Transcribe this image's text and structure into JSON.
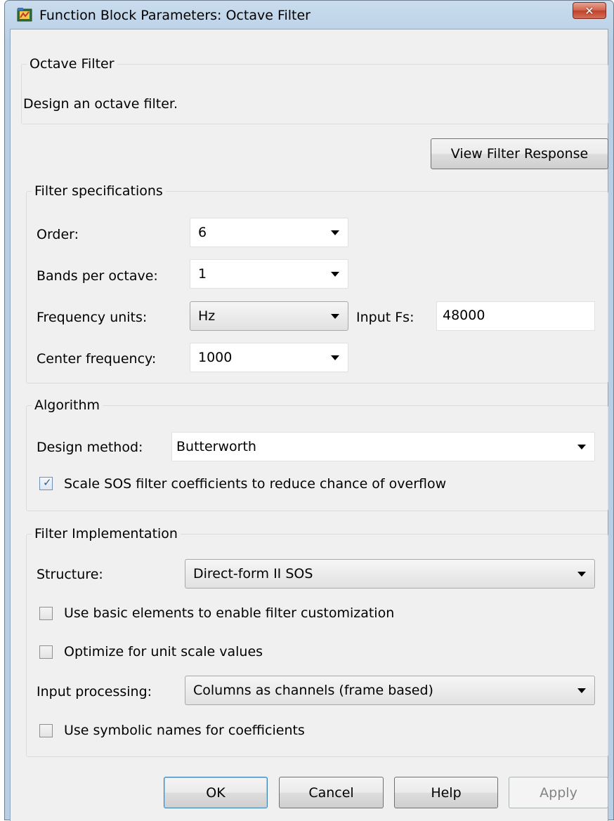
{
  "window": {
    "title": "Function Block Parameters: Octave Filter",
    "close_label": "✕"
  },
  "description_group": {
    "legend": "Octave Filter",
    "text": "Design an octave filter."
  },
  "view_filter_response_label": "View Filter Response",
  "filter_specs": {
    "legend": "Filter specifications",
    "order_label": "Order:",
    "order_value": "6",
    "bands_label": "Bands per octave:",
    "bands_value": "1",
    "freq_units_label": "Frequency units:",
    "freq_units_value": "Hz",
    "input_fs_label": "Input Fs:",
    "input_fs_value": "48000",
    "center_freq_label": "Center frequency:",
    "center_freq_value": "1000"
  },
  "algorithm": {
    "legend": "Algorithm",
    "design_method_label": "Design method:",
    "design_method_value": "Butterworth",
    "scale_sos_label": "Scale SOS filter coefficients to reduce chance of overflow",
    "scale_sos_checked": true
  },
  "implementation": {
    "legend": "Filter Implementation",
    "structure_label": "Structure:",
    "structure_value": "Direct-form II SOS",
    "basic_elements_label": "Use basic elements to enable filter customization",
    "basic_elements_checked": false,
    "optimize_label": "Optimize for unit scale values",
    "optimize_checked": false,
    "input_processing_label": "Input processing:",
    "input_processing_value": "Columns as channels (frame based)",
    "symbolic_label": "Use symbolic names for coefficients",
    "symbolic_checked": false
  },
  "buttons": {
    "ok": "OK",
    "cancel": "Cancel",
    "help": "Help",
    "apply": "Apply"
  },
  "colors": {
    "titlebar": "#b9cfe5",
    "client": "#f0f0f0",
    "close_button": "#c9503a",
    "checkbox_check": "#3b5b8b"
  },
  "icons": {
    "title": "simulink-block-icon",
    "close": "close-icon",
    "dropdown": "chevron-down-icon",
    "check": "checkmark-icon"
  }
}
